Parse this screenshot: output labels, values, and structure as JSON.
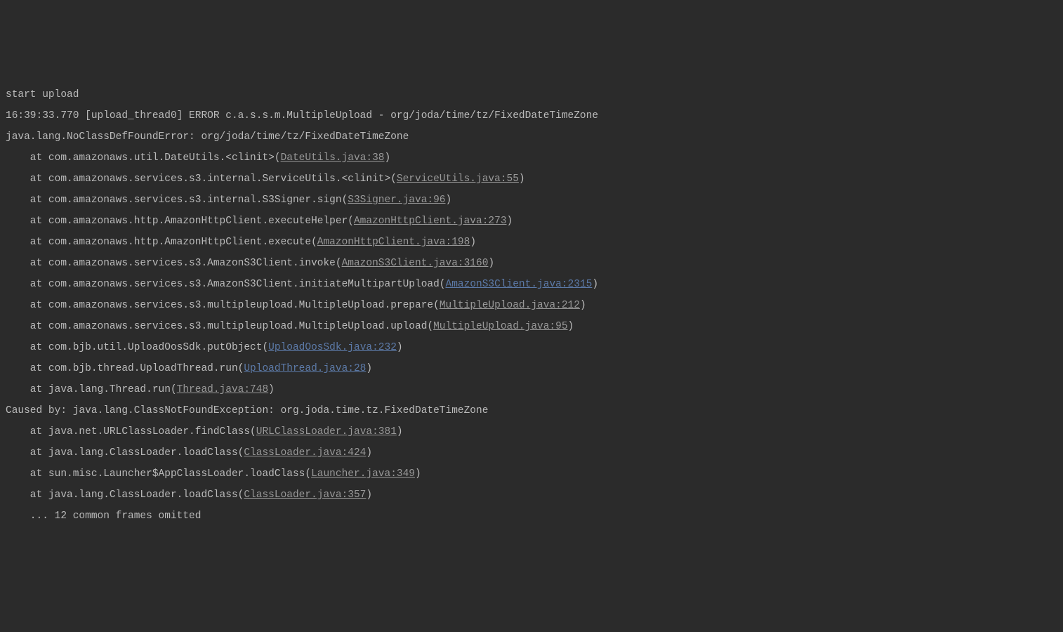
{
  "log": {
    "lines": [
      {
        "prefix": "start upload",
        "link": "",
        "suffix": "",
        "linkClass": ""
      },
      {
        "prefix": "16:39:33.770 [upload_thread0] ERROR c.a.s.s.m.MultipleUpload - org/joda/time/tz/FixedDateTimeZone",
        "link": "",
        "suffix": "",
        "linkClass": ""
      },
      {
        "prefix": "java.lang.NoClassDefFoundError: org/joda/time/tz/FixedDateTimeZone",
        "link": "",
        "suffix": "",
        "linkClass": ""
      },
      {
        "prefix": "    at com.amazonaws.util.DateUtils.<clinit>(",
        "link": "DateUtils.java:38",
        "suffix": ")",
        "linkClass": "link-normal"
      },
      {
        "prefix": "    at com.amazonaws.services.s3.internal.ServiceUtils.<clinit>(",
        "link": "ServiceUtils.java:55",
        "suffix": ")",
        "linkClass": "link-normal"
      },
      {
        "prefix": "    at com.amazonaws.services.s3.internal.S3Signer.sign(",
        "link": "S3Signer.java:96",
        "suffix": ")",
        "linkClass": "link-normal"
      },
      {
        "prefix": "    at com.amazonaws.http.AmazonHttpClient.executeHelper(",
        "link": "AmazonHttpClient.java:273",
        "suffix": ")",
        "linkClass": "link-normal"
      },
      {
        "prefix": "    at com.amazonaws.http.AmazonHttpClient.execute(",
        "link": "AmazonHttpClient.java:198",
        "suffix": ")",
        "linkClass": "link-normal"
      },
      {
        "prefix": "    at com.amazonaws.services.s3.AmazonS3Client.invoke(",
        "link": "AmazonS3Client.java:3160",
        "suffix": ")",
        "linkClass": "link-normal"
      },
      {
        "prefix": "    at com.amazonaws.services.s3.AmazonS3Client.initiateMultipartUpload(",
        "link": "AmazonS3Client.java:2315",
        "suffix": ")",
        "linkClass": "link-blue"
      },
      {
        "prefix": "    at com.amazonaws.services.s3.multipleupload.MultipleUpload.prepare(",
        "link": "MultipleUpload.java:212",
        "suffix": ")",
        "linkClass": "link-normal"
      },
      {
        "prefix": "    at com.amazonaws.services.s3.multipleupload.MultipleUpload.upload(",
        "link": "MultipleUpload.java:95",
        "suffix": ")",
        "linkClass": "link-normal"
      },
      {
        "prefix": "    at com.bjb.util.UploadOosSdk.putObject(",
        "link": "UploadOosSdk.java:232",
        "suffix": ")",
        "linkClass": "link-blue"
      },
      {
        "prefix": "    at com.bjb.thread.UploadThread.run(",
        "link": "UploadThread.java:28",
        "suffix": ")",
        "linkClass": "link-blue"
      },
      {
        "prefix": "    at java.lang.Thread.run(",
        "link": "Thread.java:748",
        "suffix": ")",
        "linkClass": "link-normal"
      },
      {
        "prefix": "Caused by: java.lang.ClassNotFoundException: org.joda.time.tz.FixedDateTimeZone",
        "link": "",
        "suffix": "",
        "linkClass": ""
      },
      {
        "prefix": "    at java.net.URLClassLoader.findClass(",
        "link": "URLClassLoader.java:381",
        "suffix": ")",
        "linkClass": "link-normal"
      },
      {
        "prefix": "    at java.lang.ClassLoader.loadClass(",
        "link": "ClassLoader.java:424",
        "suffix": ")",
        "linkClass": "link-normal"
      },
      {
        "prefix": "    at sun.misc.Launcher$AppClassLoader.loadClass(",
        "link": "Launcher.java:349",
        "suffix": ")",
        "linkClass": "link-normal"
      },
      {
        "prefix": "    at java.lang.ClassLoader.loadClass(",
        "link": "ClassLoader.java:357",
        "suffix": ")",
        "linkClass": "link-normal"
      },
      {
        "prefix": "    ... 12 common frames omitted",
        "link": "",
        "suffix": "",
        "linkClass": ""
      }
    ]
  }
}
